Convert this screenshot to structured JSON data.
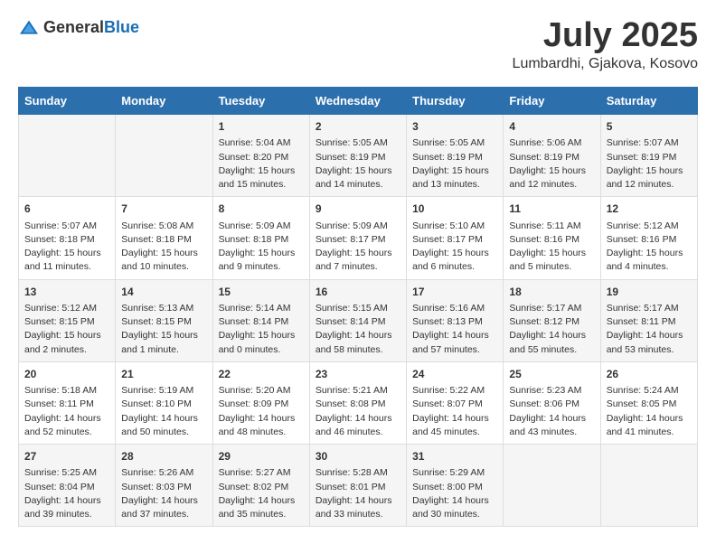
{
  "header": {
    "logo_general": "General",
    "logo_blue": "Blue",
    "month": "July 2025",
    "location": "Lumbardhi, Gjakova, Kosovo"
  },
  "days_of_week": [
    "Sunday",
    "Monday",
    "Tuesday",
    "Wednesday",
    "Thursday",
    "Friday",
    "Saturday"
  ],
  "weeks": [
    [
      {
        "day": null,
        "text": ""
      },
      {
        "day": null,
        "text": ""
      },
      {
        "day": "1",
        "text": "Sunrise: 5:04 AM\nSunset: 8:20 PM\nDaylight: 15 hours and 15 minutes."
      },
      {
        "day": "2",
        "text": "Sunrise: 5:05 AM\nSunset: 8:19 PM\nDaylight: 15 hours and 14 minutes."
      },
      {
        "day": "3",
        "text": "Sunrise: 5:05 AM\nSunset: 8:19 PM\nDaylight: 15 hours and 13 minutes."
      },
      {
        "day": "4",
        "text": "Sunrise: 5:06 AM\nSunset: 8:19 PM\nDaylight: 15 hours and 12 minutes."
      },
      {
        "day": "5",
        "text": "Sunrise: 5:07 AM\nSunset: 8:19 PM\nDaylight: 15 hours and 12 minutes."
      }
    ],
    [
      {
        "day": "6",
        "text": "Sunrise: 5:07 AM\nSunset: 8:18 PM\nDaylight: 15 hours and 11 minutes."
      },
      {
        "day": "7",
        "text": "Sunrise: 5:08 AM\nSunset: 8:18 PM\nDaylight: 15 hours and 10 minutes."
      },
      {
        "day": "8",
        "text": "Sunrise: 5:09 AM\nSunset: 8:18 PM\nDaylight: 15 hours and 9 minutes."
      },
      {
        "day": "9",
        "text": "Sunrise: 5:09 AM\nSunset: 8:17 PM\nDaylight: 15 hours and 7 minutes."
      },
      {
        "day": "10",
        "text": "Sunrise: 5:10 AM\nSunset: 8:17 PM\nDaylight: 15 hours and 6 minutes."
      },
      {
        "day": "11",
        "text": "Sunrise: 5:11 AM\nSunset: 8:16 PM\nDaylight: 15 hours and 5 minutes."
      },
      {
        "day": "12",
        "text": "Sunrise: 5:12 AM\nSunset: 8:16 PM\nDaylight: 15 hours and 4 minutes."
      }
    ],
    [
      {
        "day": "13",
        "text": "Sunrise: 5:12 AM\nSunset: 8:15 PM\nDaylight: 15 hours and 2 minutes."
      },
      {
        "day": "14",
        "text": "Sunrise: 5:13 AM\nSunset: 8:15 PM\nDaylight: 15 hours and 1 minute."
      },
      {
        "day": "15",
        "text": "Sunrise: 5:14 AM\nSunset: 8:14 PM\nDaylight: 15 hours and 0 minutes."
      },
      {
        "day": "16",
        "text": "Sunrise: 5:15 AM\nSunset: 8:14 PM\nDaylight: 14 hours and 58 minutes."
      },
      {
        "day": "17",
        "text": "Sunrise: 5:16 AM\nSunset: 8:13 PM\nDaylight: 14 hours and 57 minutes."
      },
      {
        "day": "18",
        "text": "Sunrise: 5:17 AM\nSunset: 8:12 PM\nDaylight: 14 hours and 55 minutes."
      },
      {
        "day": "19",
        "text": "Sunrise: 5:17 AM\nSunset: 8:11 PM\nDaylight: 14 hours and 53 minutes."
      }
    ],
    [
      {
        "day": "20",
        "text": "Sunrise: 5:18 AM\nSunset: 8:11 PM\nDaylight: 14 hours and 52 minutes."
      },
      {
        "day": "21",
        "text": "Sunrise: 5:19 AM\nSunset: 8:10 PM\nDaylight: 14 hours and 50 minutes."
      },
      {
        "day": "22",
        "text": "Sunrise: 5:20 AM\nSunset: 8:09 PM\nDaylight: 14 hours and 48 minutes."
      },
      {
        "day": "23",
        "text": "Sunrise: 5:21 AM\nSunset: 8:08 PM\nDaylight: 14 hours and 46 minutes."
      },
      {
        "day": "24",
        "text": "Sunrise: 5:22 AM\nSunset: 8:07 PM\nDaylight: 14 hours and 45 minutes."
      },
      {
        "day": "25",
        "text": "Sunrise: 5:23 AM\nSunset: 8:06 PM\nDaylight: 14 hours and 43 minutes."
      },
      {
        "day": "26",
        "text": "Sunrise: 5:24 AM\nSunset: 8:05 PM\nDaylight: 14 hours and 41 minutes."
      }
    ],
    [
      {
        "day": "27",
        "text": "Sunrise: 5:25 AM\nSunset: 8:04 PM\nDaylight: 14 hours and 39 minutes."
      },
      {
        "day": "28",
        "text": "Sunrise: 5:26 AM\nSunset: 8:03 PM\nDaylight: 14 hours and 37 minutes."
      },
      {
        "day": "29",
        "text": "Sunrise: 5:27 AM\nSunset: 8:02 PM\nDaylight: 14 hours and 35 minutes."
      },
      {
        "day": "30",
        "text": "Sunrise: 5:28 AM\nSunset: 8:01 PM\nDaylight: 14 hours and 33 minutes."
      },
      {
        "day": "31",
        "text": "Sunrise: 5:29 AM\nSunset: 8:00 PM\nDaylight: 14 hours and 30 minutes."
      },
      {
        "day": null,
        "text": ""
      },
      {
        "day": null,
        "text": ""
      }
    ]
  ]
}
